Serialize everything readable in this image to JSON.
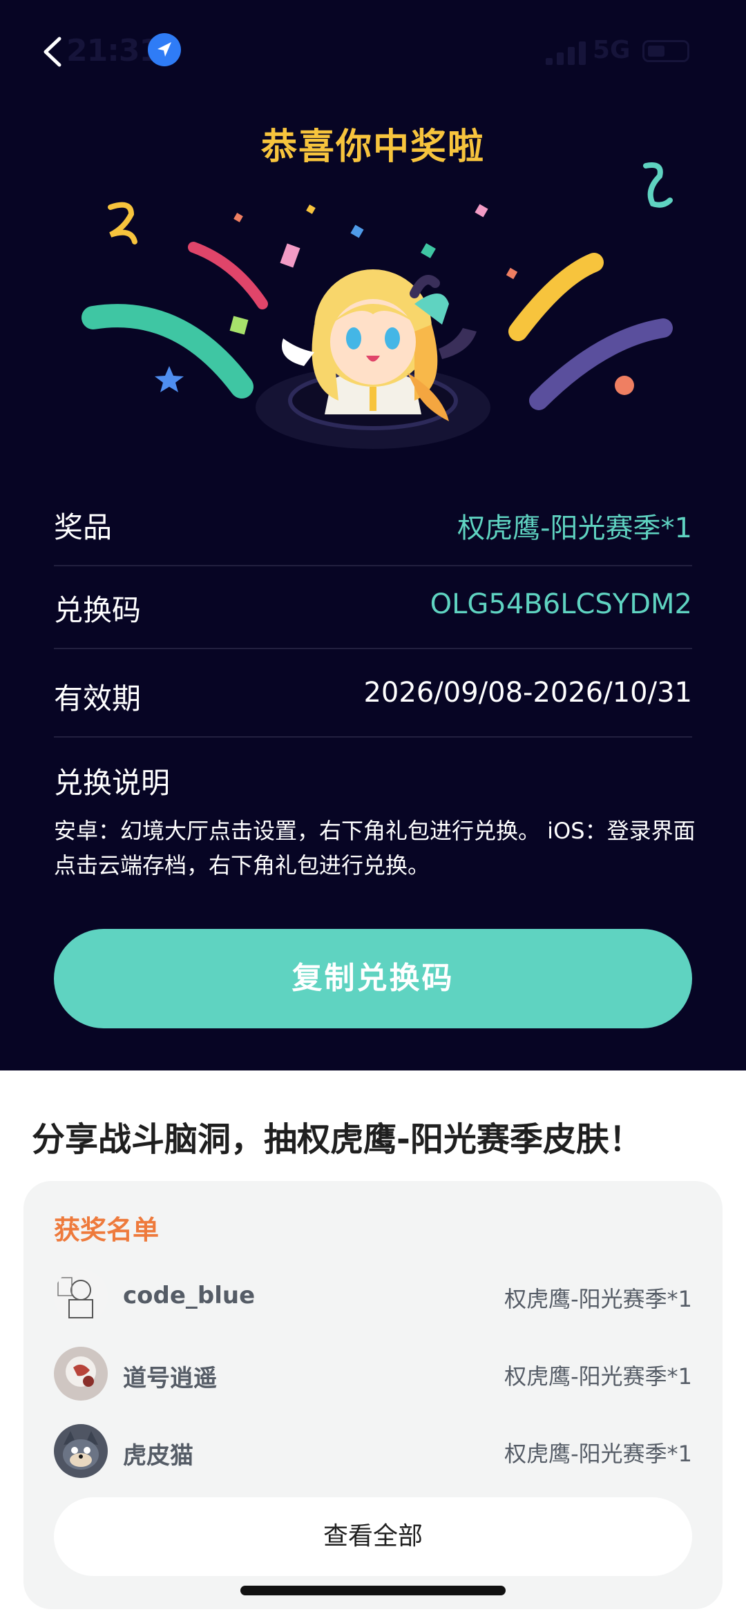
{
  "status_bar": {
    "time": "21:31",
    "network": "5G"
  },
  "header": {
    "title": "恭喜你中奖啦"
  },
  "prize_info": {
    "prize_label": "奖品",
    "prize_value": "权虎鹰-阳光赛季*1",
    "code_label": "兑换码",
    "code_value": "OLG54B6LCSYDM2",
    "validity_label": "有效期",
    "validity_value": "2026/09/08-2026/10/31",
    "explain_title": "兑换说明",
    "explain_text": "安卓：幻境大厅点击设置，右下角礼包进行兑换。 iOS：登录界面点击云端存档，右下角礼包进行兑换。",
    "copy_button": "复制兑换码"
  },
  "share": {
    "title": "分享战斗脑洞，抽权虎鹰-阳光赛季皮肤！"
  },
  "winners": {
    "title": "获奖名单",
    "items": [
      {
        "name": "code_blue",
        "prize": "权虎鹰-阳光赛季*1"
      },
      {
        "name": "道号逍遥",
        "prize": "权虎鹰-阳光赛季*1"
      },
      {
        "name": "虎皮猫",
        "prize": "权虎鹰-阳光赛季*1"
      }
    ],
    "view_all": "查看全部"
  },
  "colors": {
    "background_dark": "#070524",
    "accent_teal": "#5fd3c1",
    "title_gold": "#f7c43d",
    "winners_orange": "#ee7a3c"
  },
  "icons": [
    "back-icon",
    "location-arrow-icon",
    "signal-icon",
    "battery-icon"
  ]
}
